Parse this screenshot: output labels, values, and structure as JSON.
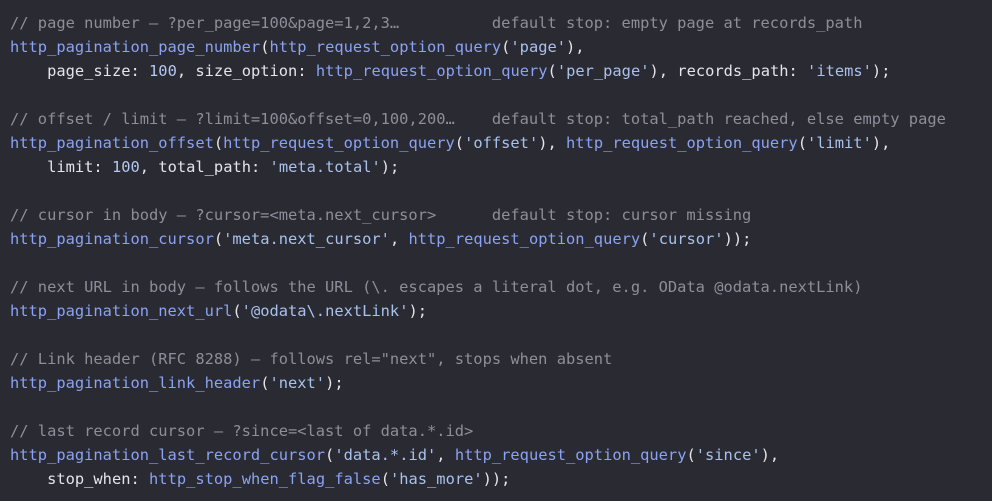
{
  "colors": {
    "background": "#2a2a33",
    "comment": "#8e8e9a",
    "function": "#8aa3f2",
    "string": "#a8c2ec",
    "number": "#b4c8f0",
    "text": "#e4e4ea"
  },
  "code": {
    "lines": [
      [
        {
          "t": "comment",
          "v": "// page number – ?per_page=100&page=1,2,3…          default stop: empty page at records_path"
        }
      ],
      [
        {
          "t": "fn",
          "v": "http_pagination_page_number"
        },
        {
          "t": "plain",
          "v": "("
        },
        {
          "t": "fn",
          "v": "http_request_option_query"
        },
        {
          "t": "plain",
          "v": "("
        },
        {
          "t": "str",
          "v": "'page'"
        },
        {
          "t": "plain",
          "v": "),"
        }
      ],
      [
        {
          "t": "plain",
          "v": "    "
        },
        {
          "t": "key",
          "v": "page_size"
        },
        {
          "t": "plain",
          "v": ": "
        },
        {
          "t": "num",
          "v": "100"
        },
        {
          "t": "plain",
          "v": ", "
        },
        {
          "t": "key",
          "v": "size_option"
        },
        {
          "t": "plain",
          "v": ": "
        },
        {
          "t": "fn",
          "v": "http_request_option_query"
        },
        {
          "t": "plain",
          "v": "("
        },
        {
          "t": "str",
          "v": "'per_page'"
        },
        {
          "t": "plain",
          "v": "), "
        },
        {
          "t": "key",
          "v": "records_path"
        },
        {
          "t": "plain",
          "v": ": "
        },
        {
          "t": "str",
          "v": "'items'"
        },
        {
          "t": "plain",
          "v": ");"
        }
      ],
      [],
      [
        {
          "t": "comment",
          "v": "// offset / limit – ?limit=100&offset=0,100,200…    default stop: total_path reached, else empty page"
        }
      ],
      [
        {
          "t": "fn",
          "v": "http_pagination_offset"
        },
        {
          "t": "plain",
          "v": "("
        },
        {
          "t": "fn",
          "v": "http_request_option_query"
        },
        {
          "t": "plain",
          "v": "("
        },
        {
          "t": "str",
          "v": "'offset'"
        },
        {
          "t": "plain",
          "v": "), "
        },
        {
          "t": "fn",
          "v": "http_request_option_query"
        },
        {
          "t": "plain",
          "v": "("
        },
        {
          "t": "str",
          "v": "'limit'"
        },
        {
          "t": "plain",
          "v": "),"
        }
      ],
      [
        {
          "t": "plain",
          "v": "    "
        },
        {
          "t": "key",
          "v": "limit"
        },
        {
          "t": "plain",
          "v": ": "
        },
        {
          "t": "num",
          "v": "100"
        },
        {
          "t": "plain",
          "v": ", "
        },
        {
          "t": "key",
          "v": "total_path"
        },
        {
          "t": "plain",
          "v": ": "
        },
        {
          "t": "str",
          "v": "'meta.total'"
        },
        {
          "t": "plain",
          "v": ");"
        }
      ],
      [],
      [
        {
          "t": "comment",
          "v": "// cursor in body – ?cursor=<meta.next_cursor>      default stop: cursor missing"
        }
      ],
      [
        {
          "t": "fn",
          "v": "http_pagination_cursor"
        },
        {
          "t": "plain",
          "v": "("
        },
        {
          "t": "str",
          "v": "'meta.next_cursor'"
        },
        {
          "t": "plain",
          "v": ", "
        },
        {
          "t": "fn",
          "v": "http_request_option_query"
        },
        {
          "t": "plain",
          "v": "("
        },
        {
          "t": "str",
          "v": "'cursor'"
        },
        {
          "t": "plain",
          "v": "));"
        }
      ],
      [],
      [
        {
          "t": "comment",
          "v": "// next URL in body – follows the URL (\\. escapes a literal dot, e.g. OData @odata.nextLink)"
        }
      ],
      [
        {
          "t": "fn",
          "v": "http_pagination_next_url"
        },
        {
          "t": "plain",
          "v": "("
        },
        {
          "t": "str",
          "v": "'@odata\\.nextLink'"
        },
        {
          "t": "plain",
          "v": ");"
        }
      ],
      [],
      [
        {
          "t": "comment",
          "v": "// Link header (RFC 8288) – follows rel=\"next\", stops when absent"
        }
      ],
      [
        {
          "t": "fn",
          "v": "http_pagination_link_header"
        },
        {
          "t": "plain",
          "v": "("
        },
        {
          "t": "str",
          "v": "'next'"
        },
        {
          "t": "plain",
          "v": ");"
        }
      ],
      [],
      [
        {
          "t": "comment",
          "v": "// last record cursor – ?since=<last of data.*.id>"
        }
      ],
      [
        {
          "t": "fn",
          "v": "http_pagination_last_record_cursor"
        },
        {
          "t": "plain",
          "v": "("
        },
        {
          "t": "str",
          "v": "'data.*.id'"
        },
        {
          "t": "plain",
          "v": ", "
        },
        {
          "t": "fn",
          "v": "http_request_option_query"
        },
        {
          "t": "plain",
          "v": "("
        },
        {
          "t": "str",
          "v": "'since'"
        },
        {
          "t": "plain",
          "v": "),"
        }
      ],
      [
        {
          "t": "plain",
          "v": "    "
        },
        {
          "t": "key",
          "v": "stop_when"
        },
        {
          "t": "plain",
          "v": ": "
        },
        {
          "t": "fn",
          "v": "http_stop_when_flag_false"
        },
        {
          "t": "plain",
          "v": "("
        },
        {
          "t": "str",
          "v": "'has_more'"
        },
        {
          "t": "plain",
          "v": "));"
        }
      ]
    ]
  }
}
